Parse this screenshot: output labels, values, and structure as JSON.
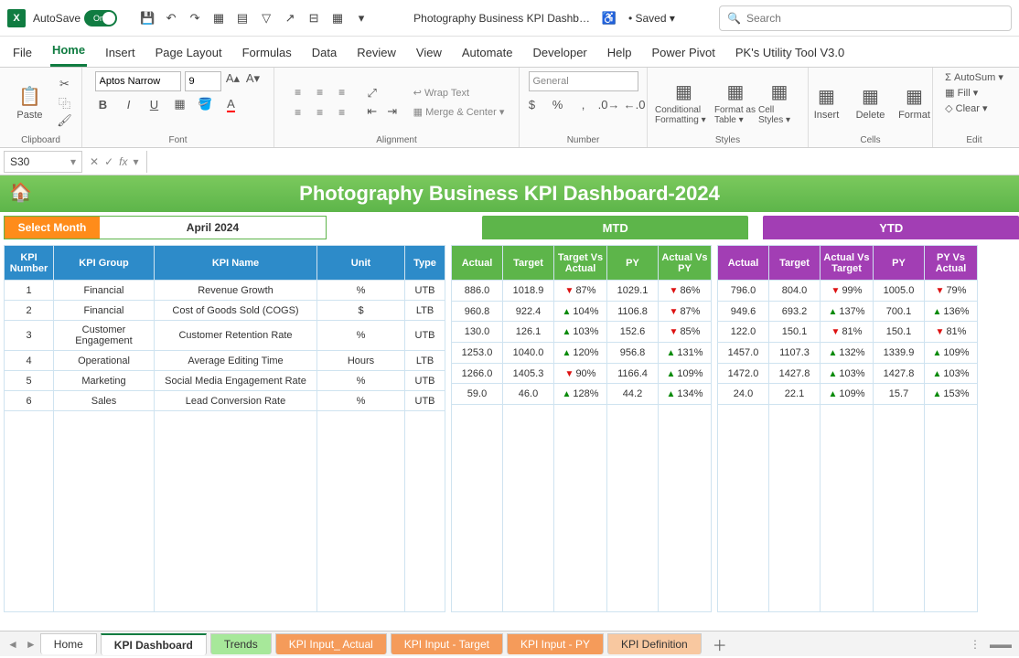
{
  "titlebar": {
    "autosave_label": "AutoSave",
    "autosave_state": "On",
    "doc_title": "Photography Business KPI Dashb…",
    "saved_state": "• Saved ▾",
    "search_placeholder": "Search"
  },
  "ribbon_tabs": [
    "File",
    "Home",
    "Insert",
    "Page Layout",
    "Formulas",
    "Data",
    "Review",
    "View",
    "Automate",
    "Developer",
    "Help",
    "Power Pivot",
    "PK's Utility Tool V3.0"
  ],
  "ribbon_active_tab": "Home",
  "ribbon": {
    "clipboard_label": "Clipboard",
    "paste_label": "Paste",
    "font_label": "Font",
    "font_name": "Aptos Narrow",
    "font_size": "9",
    "alignment_label": "Alignment",
    "wrap_label": "Wrap Text",
    "merge_label": "Merge & Center",
    "number_label": "Number",
    "number_format": "General",
    "styles_label": "Styles",
    "cond_fmt": "Conditional Formatting ▾",
    "fmt_table": "Format as Table ▾",
    "cell_styles": "Cell Styles ▾",
    "cells_label": "Cells",
    "insert_btn": "Insert",
    "delete_btn": "Delete",
    "format_btn": "Format",
    "edit_label": "Edit",
    "autosum": "AutoSum ▾",
    "fill": "Fill ▾",
    "clear": "Clear ▾"
  },
  "formula_bar": {
    "cell_ref": "S30"
  },
  "dashboard": {
    "title": "Photography Business KPI Dashboard-2024",
    "select_month_label": "Select Month",
    "selected_month": "April 2024",
    "mtd_label": "MTD",
    "ytd_label": "YTD",
    "desc_headers": {
      "num": "KPI Number",
      "grp": "KPI Group",
      "name": "KPI Name",
      "unit": "Unit",
      "type": "Type"
    },
    "mtd_headers": {
      "actual": "Actual",
      "target": "Target",
      "tvsa": "Target Vs Actual",
      "py": "PY",
      "avp": "Actual Vs PY"
    },
    "ytd_headers": {
      "actual": "Actual",
      "target": "Target",
      "avt": "Actual Vs Target",
      "py": "PY",
      "pva": "PY Vs Actual"
    },
    "rows": [
      {
        "num": "1",
        "grp": "Financial",
        "name": "Revenue Growth",
        "unit": "%",
        "type": "UTB",
        "mtd": {
          "actual": "886.0",
          "target": "1018.9",
          "tvsa": "87%",
          "tvsa_dir": "dn",
          "py": "1029.1",
          "avp": "86%",
          "avp_dir": "dn"
        },
        "ytd": {
          "actual": "796.0",
          "target": "804.0",
          "avt": "99%",
          "avt_dir": "dn",
          "py": "1005.0",
          "pva": "79%",
          "pva_dir": "dn"
        }
      },
      {
        "num": "2",
        "grp": "Financial",
        "name": "Cost of Goods Sold (COGS)",
        "unit": "$",
        "type": "LTB",
        "mtd": {
          "actual": "960.8",
          "target": "922.4",
          "tvsa": "104%",
          "tvsa_dir": "up",
          "py": "1106.8",
          "avp": "87%",
          "avp_dir": "dn"
        },
        "ytd": {
          "actual": "949.6",
          "target": "693.2",
          "avt": "137%",
          "avt_dir": "up",
          "py": "700.1",
          "pva": "136%",
          "pva_dir": "up"
        }
      },
      {
        "num": "3",
        "grp": "Customer Engagement",
        "name": "Customer Retention Rate",
        "unit": "%",
        "type": "UTB",
        "mtd": {
          "actual": "130.0",
          "target": "126.1",
          "tvsa": "103%",
          "tvsa_dir": "up",
          "py": "152.6",
          "avp": "85%",
          "avp_dir": "dn"
        },
        "ytd": {
          "actual": "122.0",
          "target": "150.1",
          "avt": "81%",
          "avt_dir": "dn",
          "py": "150.1",
          "pva": "81%",
          "pva_dir": "dn"
        }
      },
      {
        "num": "4",
        "grp": "Operational",
        "name": "Average Editing Time",
        "unit": "Hours",
        "type": "LTB",
        "mtd": {
          "actual": "1253.0",
          "target": "1040.0",
          "tvsa": "120%",
          "tvsa_dir": "up",
          "py": "956.8",
          "avp": "131%",
          "avp_dir": "up"
        },
        "ytd": {
          "actual": "1457.0",
          "target": "1107.3",
          "avt": "132%",
          "avt_dir": "up",
          "py": "1339.9",
          "pva": "109%",
          "pva_dir": "up"
        }
      },
      {
        "num": "5",
        "grp": "Marketing",
        "name": "Social Media Engagement Rate",
        "unit": "%",
        "type": "UTB",
        "mtd": {
          "actual": "1266.0",
          "target": "1405.3",
          "tvsa": "90%",
          "tvsa_dir": "dn",
          "py": "1166.4",
          "avp": "109%",
          "avp_dir": "up"
        },
        "ytd": {
          "actual": "1472.0",
          "target": "1427.8",
          "avt": "103%",
          "avt_dir": "up",
          "py": "1427.8",
          "pva": "103%",
          "pva_dir": "up"
        }
      },
      {
        "num": "6",
        "grp": "Sales",
        "name": "Lead Conversion Rate",
        "unit": "%",
        "type": "UTB",
        "mtd": {
          "actual": "59.0",
          "target": "46.0",
          "tvsa": "128%",
          "tvsa_dir": "up",
          "py": "44.2",
          "avp": "134%",
          "avp_dir": "up"
        },
        "ytd": {
          "actual": "24.0",
          "target": "22.1",
          "avt": "109%",
          "avt_dir": "up",
          "py": "15.7",
          "pva": "153%",
          "pva_dir": "up"
        }
      }
    ]
  },
  "sheet_tabs": {
    "home": "Home",
    "dash": "KPI Dashboard",
    "trends": "Trends",
    "input_actual": "KPI Input_ Actual",
    "input_target": "KPI Input - Target",
    "input_py": "KPI Input - PY",
    "def": "KPI Definition"
  }
}
